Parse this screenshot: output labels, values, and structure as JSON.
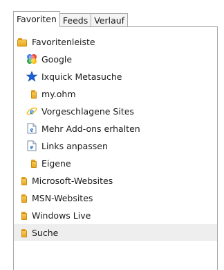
{
  "tabs": [
    {
      "label": "Favoriten",
      "active": true
    },
    {
      "label": "Feeds",
      "active": false
    },
    {
      "label": "Verlauf",
      "active": false
    }
  ],
  "tree": [
    {
      "label": "Favoritenleiste",
      "icon": "folder-icon",
      "level": 0
    },
    {
      "label": "Google",
      "icon": "google-icon",
      "level": 1
    },
    {
      "label": "Ixquick Metasuche",
      "icon": "star-icon",
      "level": 1
    },
    {
      "label": "my.ohm",
      "icon": "folder-icon",
      "level": 1
    },
    {
      "label": "Vorgeschlagene Sites",
      "icon": "ie-icon",
      "level": 1
    },
    {
      "label": "Mehr Add-ons erhalten",
      "icon": "ie-page-icon",
      "level": 1
    },
    {
      "label": "Links anpassen",
      "icon": "ie-page-icon",
      "level": 1
    },
    {
      "label": "Eigene",
      "icon": "folder-icon",
      "level": 1
    },
    {
      "label": "Microsoft-Websites",
      "icon": "folder-icon",
      "level": 0
    },
    {
      "label": "MSN-Websites",
      "icon": "folder-icon",
      "level": 0
    },
    {
      "label": "Windows Live",
      "icon": "folder-icon",
      "level": 0
    },
    {
      "label": "Suche",
      "icon": "folder-icon",
      "level": 0,
      "selected": true
    }
  ]
}
